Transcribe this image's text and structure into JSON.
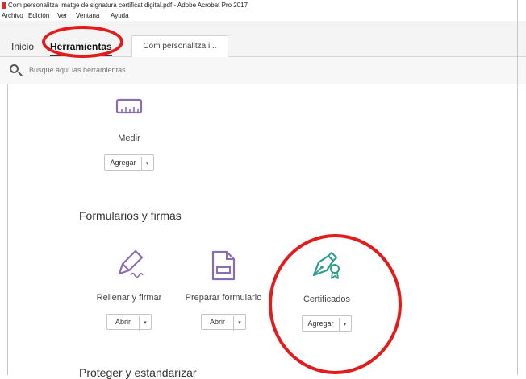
{
  "window": {
    "title": "Com personalitza imatge de signatura certificat digital.pdf - Adobe Acrobat Pro 2017"
  },
  "menu": [
    "Archivo",
    "Edición",
    "Ver",
    "Ventana",
    "Ayuda"
  ],
  "tabs": {
    "inicio": "Inicio",
    "herramientas": "Herramientas",
    "document": "Com personalitza i..."
  },
  "search": {
    "placeholder": "Busque aquí las herramientas"
  },
  "tools": {
    "medir": {
      "label": "Medir",
      "button": "Agregar",
      "drop": "▾"
    },
    "rellenar": {
      "label": "Rellenar y firmar",
      "button": "Abrir",
      "drop": "▾"
    },
    "preparar": {
      "label": "Preparar formulario",
      "button": "Abrir",
      "drop": "▾"
    },
    "certificados": {
      "label": "Certificados",
      "button": "Agregar",
      "drop": "▾"
    }
  },
  "sections": {
    "forms": "Formularios y firmas",
    "protect": "Proteger y estandarizar"
  },
  "colors": {
    "accent_purple": "#8a6cb3",
    "accent_teal": "#2e9c8c",
    "annotation": "#e31b1b"
  }
}
